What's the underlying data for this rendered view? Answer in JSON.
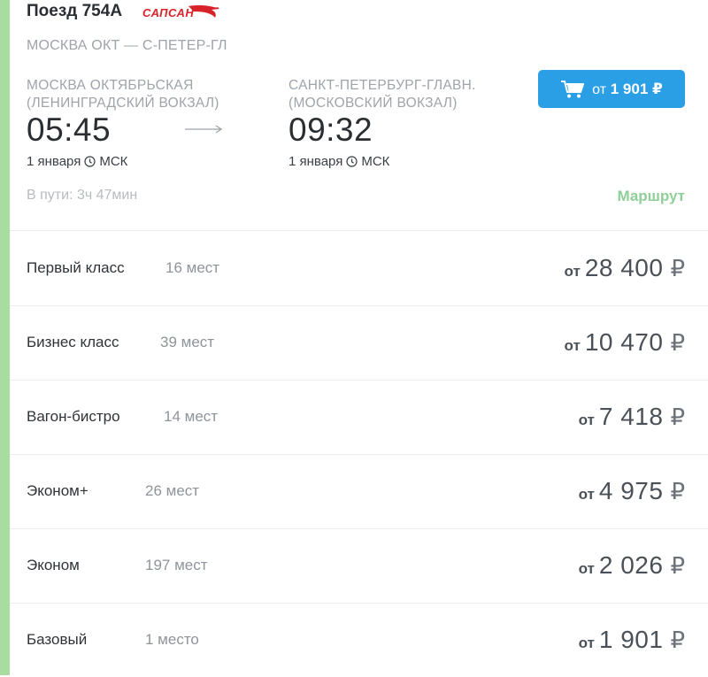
{
  "train": {
    "title": "Поезд 754А",
    "brand": "САПСАН",
    "brand_color": "#d8232a"
  },
  "route_name": "МОСКВА ОКТ — С-ПЕТЕР-ГЛ",
  "departure": {
    "station_line1": "МОСКВА ОКТЯБРЬСКАЯ",
    "station_line2": "(ЛЕНИНГРАДСКИЙ ВОКЗАЛ)",
    "time": "05:45",
    "date": "1 января",
    "tz": "МСК"
  },
  "arrival": {
    "station_line1": "САНКТ-ПЕТЕРБУРГ-ГЛАВН.",
    "station_line2": "(МОСКОВСКИЙ ВОКЗАЛ)",
    "time": "09:32",
    "date": "1 января",
    "tz": "МСК"
  },
  "buy_button": {
    "icon": "cart-icon",
    "from": "от",
    "price": "1 901 ₽",
    "color": "#2b9fe6"
  },
  "duration": "В пути: 3ч 47мин",
  "route_link": "Маршрут",
  "accent_color": "#a9dca0",
  "fares": [
    {
      "class": "Первый класс",
      "seats": "16 мест",
      "from": "от",
      "price": "28 400",
      "currency": "₽"
    },
    {
      "class": "Бизнес класс",
      "seats": "39 мест",
      "from": "от",
      "price": "10 470",
      "currency": "₽"
    },
    {
      "class": "Вагон-бистро",
      "seats": "14 мест",
      "from": "от",
      "price": "7 418",
      "currency": "₽"
    },
    {
      "class": "Эконом+",
      "seats": "26 мест",
      "from": "от",
      "price": "4 975",
      "currency": "₽"
    },
    {
      "class": "Эконом",
      "seats": "197 мест",
      "from": "от",
      "price": "2 026",
      "currency": "₽"
    },
    {
      "class": "Базовый",
      "seats": "1 место",
      "from": "от",
      "price": "1 901",
      "currency": "₽"
    }
  ]
}
